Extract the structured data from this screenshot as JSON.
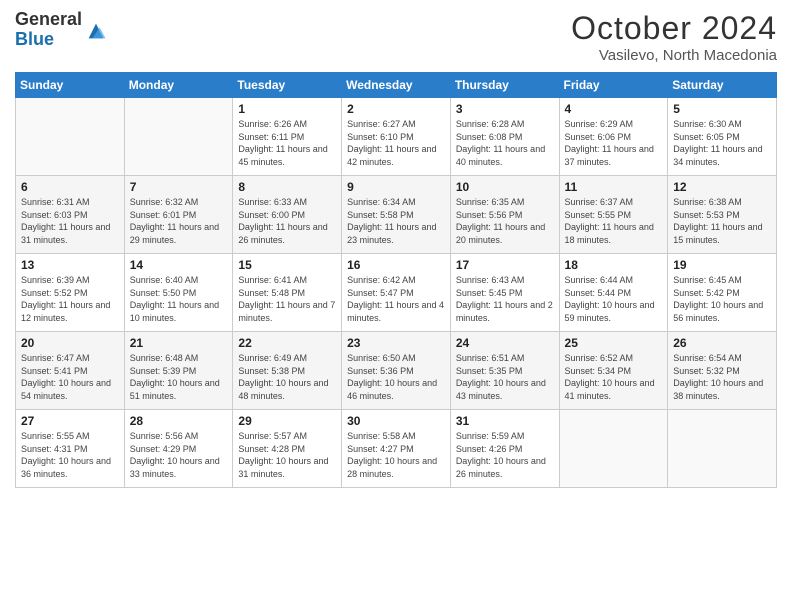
{
  "header": {
    "logo_general": "General",
    "logo_blue": "Blue",
    "month_title": "October 2024",
    "location": "Vasilevo, North Macedonia"
  },
  "calendar": {
    "days_of_week": [
      "Sunday",
      "Monday",
      "Tuesday",
      "Wednesday",
      "Thursday",
      "Friday",
      "Saturday"
    ],
    "weeks": [
      [
        {
          "day": "",
          "info": ""
        },
        {
          "day": "",
          "info": ""
        },
        {
          "day": "1",
          "info": "Sunrise: 6:26 AM\nSunset: 6:11 PM\nDaylight: 11 hours and 45 minutes."
        },
        {
          "day": "2",
          "info": "Sunrise: 6:27 AM\nSunset: 6:10 PM\nDaylight: 11 hours and 42 minutes."
        },
        {
          "day": "3",
          "info": "Sunrise: 6:28 AM\nSunset: 6:08 PM\nDaylight: 11 hours and 40 minutes."
        },
        {
          "day": "4",
          "info": "Sunrise: 6:29 AM\nSunset: 6:06 PM\nDaylight: 11 hours and 37 minutes."
        },
        {
          "day": "5",
          "info": "Sunrise: 6:30 AM\nSunset: 6:05 PM\nDaylight: 11 hours and 34 minutes."
        }
      ],
      [
        {
          "day": "6",
          "info": "Sunrise: 6:31 AM\nSunset: 6:03 PM\nDaylight: 11 hours and 31 minutes."
        },
        {
          "day": "7",
          "info": "Sunrise: 6:32 AM\nSunset: 6:01 PM\nDaylight: 11 hours and 29 minutes."
        },
        {
          "day": "8",
          "info": "Sunrise: 6:33 AM\nSunset: 6:00 PM\nDaylight: 11 hours and 26 minutes."
        },
        {
          "day": "9",
          "info": "Sunrise: 6:34 AM\nSunset: 5:58 PM\nDaylight: 11 hours and 23 minutes."
        },
        {
          "day": "10",
          "info": "Sunrise: 6:35 AM\nSunset: 5:56 PM\nDaylight: 11 hours and 20 minutes."
        },
        {
          "day": "11",
          "info": "Sunrise: 6:37 AM\nSunset: 5:55 PM\nDaylight: 11 hours and 18 minutes."
        },
        {
          "day": "12",
          "info": "Sunrise: 6:38 AM\nSunset: 5:53 PM\nDaylight: 11 hours and 15 minutes."
        }
      ],
      [
        {
          "day": "13",
          "info": "Sunrise: 6:39 AM\nSunset: 5:52 PM\nDaylight: 11 hours and 12 minutes."
        },
        {
          "day": "14",
          "info": "Sunrise: 6:40 AM\nSunset: 5:50 PM\nDaylight: 11 hours and 10 minutes."
        },
        {
          "day": "15",
          "info": "Sunrise: 6:41 AM\nSunset: 5:48 PM\nDaylight: 11 hours and 7 minutes."
        },
        {
          "day": "16",
          "info": "Sunrise: 6:42 AM\nSunset: 5:47 PM\nDaylight: 11 hours and 4 minutes."
        },
        {
          "day": "17",
          "info": "Sunrise: 6:43 AM\nSunset: 5:45 PM\nDaylight: 11 hours and 2 minutes."
        },
        {
          "day": "18",
          "info": "Sunrise: 6:44 AM\nSunset: 5:44 PM\nDaylight: 10 hours and 59 minutes."
        },
        {
          "day": "19",
          "info": "Sunrise: 6:45 AM\nSunset: 5:42 PM\nDaylight: 10 hours and 56 minutes."
        }
      ],
      [
        {
          "day": "20",
          "info": "Sunrise: 6:47 AM\nSunset: 5:41 PM\nDaylight: 10 hours and 54 minutes."
        },
        {
          "day": "21",
          "info": "Sunrise: 6:48 AM\nSunset: 5:39 PM\nDaylight: 10 hours and 51 minutes."
        },
        {
          "day": "22",
          "info": "Sunrise: 6:49 AM\nSunset: 5:38 PM\nDaylight: 10 hours and 48 minutes."
        },
        {
          "day": "23",
          "info": "Sunrise: 6:50 AM\nSunset: 5:36 PM\nDaylight: 10 hours and 46 minutes."
        },
        {
          "day": "24",
          "info": "Sunrise: 6:51 AM\nSunset: 5:35 PM\nDaylight: 10 hours and 43 minutes."
        },
        {
          "day": "25",
          "info": "Sunrise: 6:52 AM\nSunset: 5:34 PM\nDaylight: 10 hours and 41 minutes."
        },
        {
          "day": "26",
          "info": "Sunrise: 6:54 AM\nSunset: 5:32 PM\nDaylight: 10 hours and 38 minutes."
        }
      ],
      [
        {
          "day": "27",
          "info": "Sunrise: 5:55 AM\nSunset: 4:31 PM\nDaylight: 10 hours and 36 minutes."
        },
        {
          "day": "28",
          "info": "Sunrise: 5:56 AM\nSunset: 4:29 PM\nDaylight: 10 hours and 33 minutes."
        },
        {
          "day": "29",
          "info": "Sunrise: 5:57 AM\nSunset: 4:28 PM\nDaylight: 10 hours and 31 minutes."
        },
        {
          "day": "30",
          "info": "Sunrise: 5:58 AM\nSunset: 4:27 PM\nDaylight: 10 hours and 28 minutes."
        },
        {
          "day": "31",
          "info": "Sunrise: 5:59 AM\nSunset: 4:26 PM\nDaylight: 10 hours and 26 minutes."
        },
        {
          "day": "",
          "info": ""
        },
        {
          "day": "",
          "info": ""
        }
      ]
    ]
  }
}
